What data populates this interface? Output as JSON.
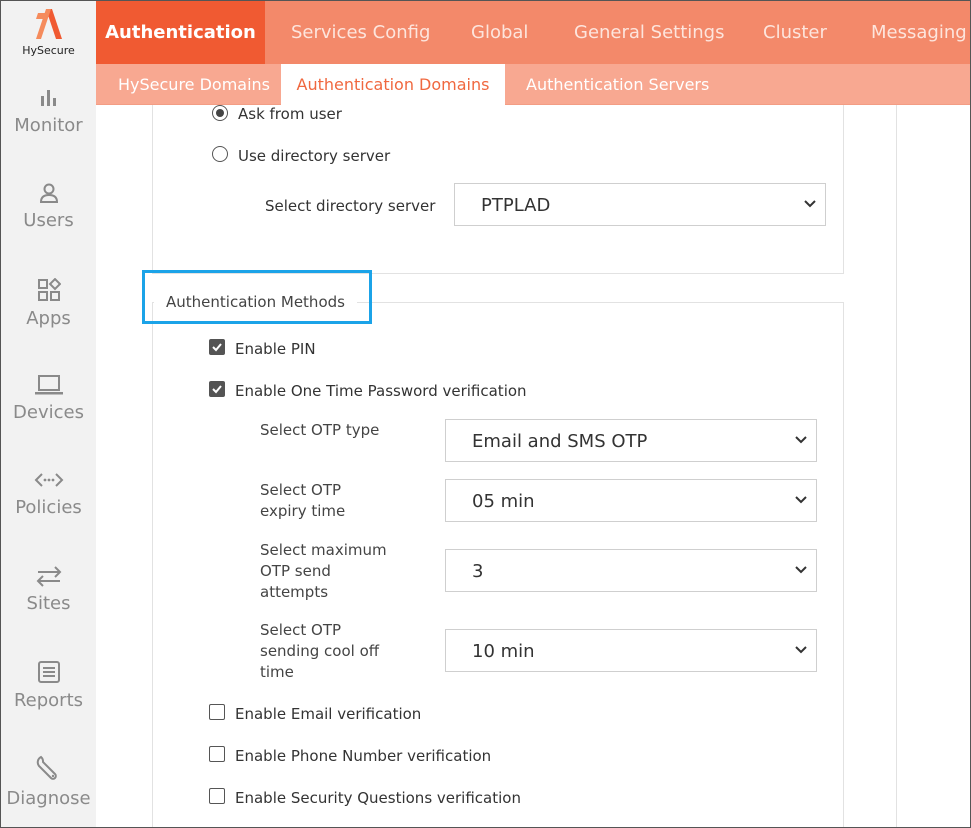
{
  "brand": {
    "name": "HySecure",
    "accent": "#f05a32",
    "highlight": "#1ba3e8"
  },
  "sidebar": {
    "items": [
      {
        "label": "Monitor",
        "icon": "bar-chart-icon"
      },
      {
        "label": "Users",
        "icon": "user-icon"
      },
      {
        "label": "Apps",
        "icon": "apps-icon"
      },
      {
        "label": "Devices",
        "icon": "laptop-icon"
      },
      {
        "label": "Policies",
        "icon": "code-arrows-icon"
      },
      {
        "label": "Sites",
        "icon": "swap-arrows-icon"
      },
      {
        "label": "Reports",
        "icon": "document-icon"
      },
      {
        "label": "Diagnose",
        "icon": "wrench-icon"
      }
    ]
  },
  "top_tabs": [
    "Authentication",
    "Services Config",
    "Global",
    "General Settings",
    "Cluster",
    "Messaging"
  ],
  "sub_tabs": [
    "HySecure Domains",
    "Authentication Domains",
    "Authentication Servers"
  ],
  "form": {
    "ask_from_user": "Ask from user",
    "use_directory_server": "Use directory server",
    "select_directory_server_label": "Select directory server",
    "directory_server_value": "PTPLAD",
    "auth_methods_legend": "Authentication Methods",
    "enable_pin": "Enable PIN",
    "enable_otp": "Enable One Time Password verification",
    "otp_type_label": "Select OTP type",
    "otp_type_value": "Email and SMS OTP",
    "otp_expiry_label": "Select OTP expiry time",
    "otp_expiry_value": "05 min",
    "otp_max_attempts_label": "Select maximum OTP send attempts",
    "otp_max_attempts_value": "3",
    "otp_cooloff_label": "Select OTP sending cool off time",
    "otp_cooloff_value": "10 min",
    "enable_email": "Enable Email verification",
    "enable_phone": "Enable Phone Number verification",
    "enable_security_questions": "Enable Security Questions verification"
  }
}
